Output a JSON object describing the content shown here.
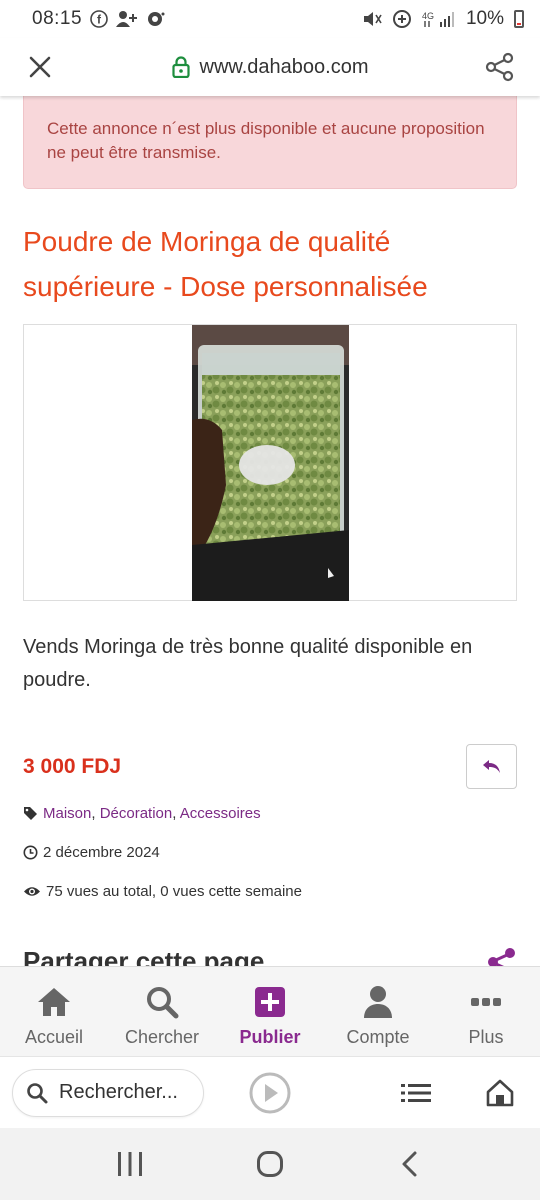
{
  "status_bar": {
    "time": "08:15",
    "battery": "10%",
    "network": "4G"
  },
  "browser": {
    "url": "www.dahaboo.com"
  },
  "alert": {
    "text": "Cette annonce n´est plus disponible et aucune proposition ne peut être transmise."
  },
  "listing": {
    "title": "Poudre de Moringa de qualité supérieure - Dose personnalisée",
    "description": "Vends Moringa de très bonne qualité disponible en poudre.",
    "price": "3 000 FDJ",
    "categories": [
      "Maison",
      "Décoration",
      "Accessoires"
    ],
    "category_sep": ", ",
    "date": "2 décembre 2024",
    "views": "75 vues au total, 0 vues cette semaine",
    "share_title": "Partager cette page"
  },
  "app_nav": {
    "items": [
      {
        "label": "Accueil",
        "icon": "home-icon"
      },
      {
        "label": "Chercher",
        "icon": "search-icon"
      },
      {
        "label": "Publier",
        "icon": "plus-square-icon"
      },
      {
        "label": "Compte",
        "icon": "user-icon"
      },
      {
        "label": "Plus",
        "icon": "more-dots-icon"
      }
    ],
    "active": "Publier"
  },
  "browser_bottom": {
    "search_placeholder": "Rechercher..."
  },
  "colors": {
    "title": "#e8491d",
    "price": "#d9301c",
    "accent_purple": "#8a2a8f",
    "alert_bg": "#f8d7da",
    "alert_text": "#a94442",
    "lock_green": "#1e8e3e"
  }
}
